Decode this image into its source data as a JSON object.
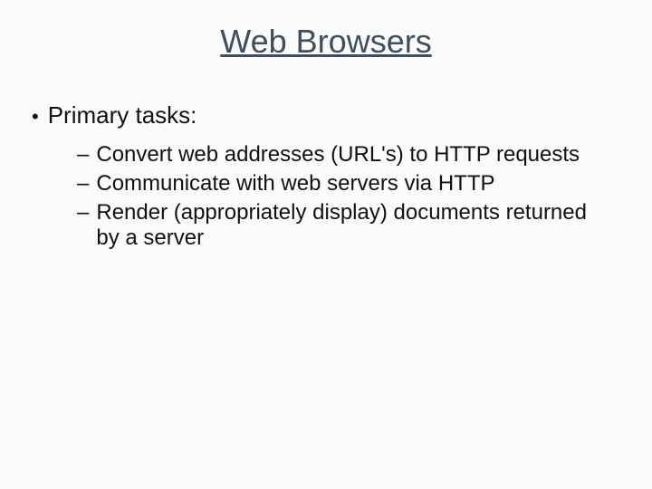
{
  "title": "Web Browsers",
  "bullet": "Primary tasks:",
  "subitems": [
    "Convert web addresses (URL's) to HTTP requests",
    "Communicate with web servers via HTTP",
    "Render (appropriately display) documents returned by a server"
  ]
}
